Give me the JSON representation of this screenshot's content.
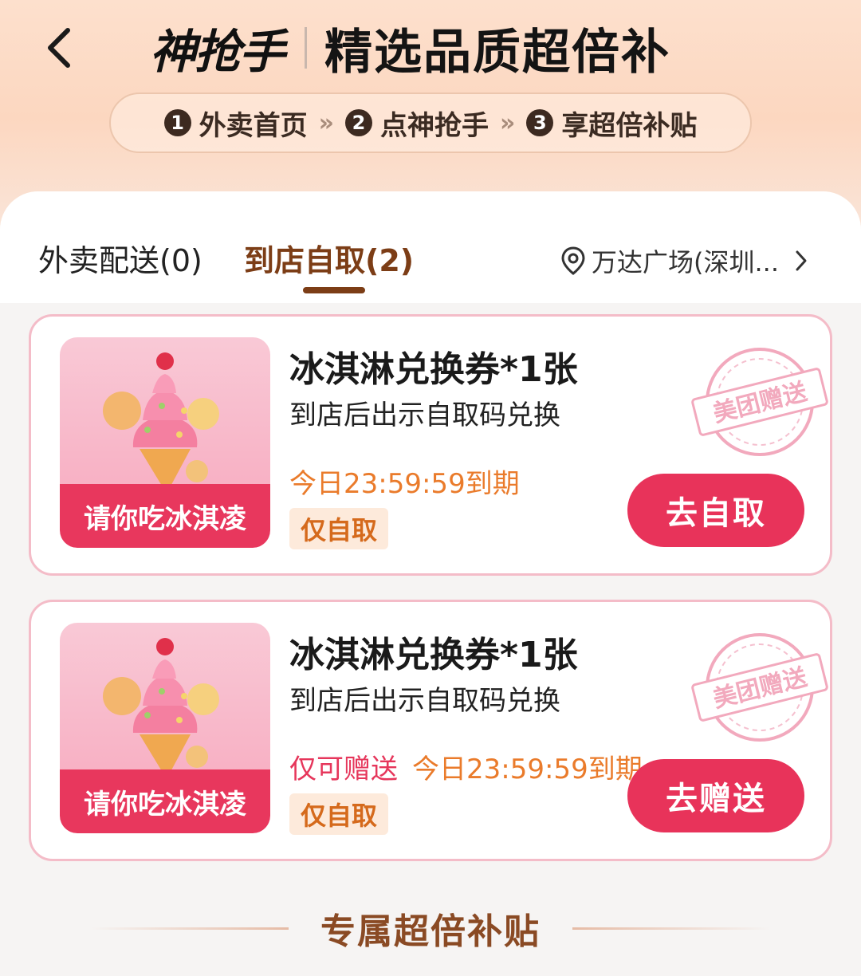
{
  "header": {
    "brand": "神抢手",
    "subtitle": "精选品质超倍补"
  },
  "steps": [
    {
      "num": "1",
      "label": "外卖首页"
    },
    {
      "num": "2",
      "label": "点神抢手"
    },
    {
      "num": "3",
      "label": "享超倍补贴"
    }
  ],
  "step_separator": "»",
  "tabs": {
    "delivery": "外卖配送(0)",
    "pickup": "到店自取(2)"
  },
  "location": "万达广场(深圳...",
  "cards": [
    {
      "image_label": "请你吃冰淇凌",
      "title": "冰淇淋兑换券*1张",
      "desc": "到店后出示自取码兑换",
      "gift_only": "",
      "expire": "今日23:59:59到期",
      "tag": "仅自取",
      "button": "去自取",
      "stamp": "美团赠送"
    },
    {
      "image_label": "请你吃冰淇凌",
      "title": "冰淇淋兑换券*1张",
      "desc": "到店后出示自取码兑换",
      "gift_only": "仅可赠送",
      "expire": "今日23:59:59到期",
      "tag": "仅自取",
      "button": "去赠送",
      "stamp": "美团赠送"
    }
  ],
  "section_title": "专属超倍补贴",
  "colors": {
    "accent": "#e8335a",
    "brown": "#7c3d16",
    "orange": "#ea7b2b"
  }
}
